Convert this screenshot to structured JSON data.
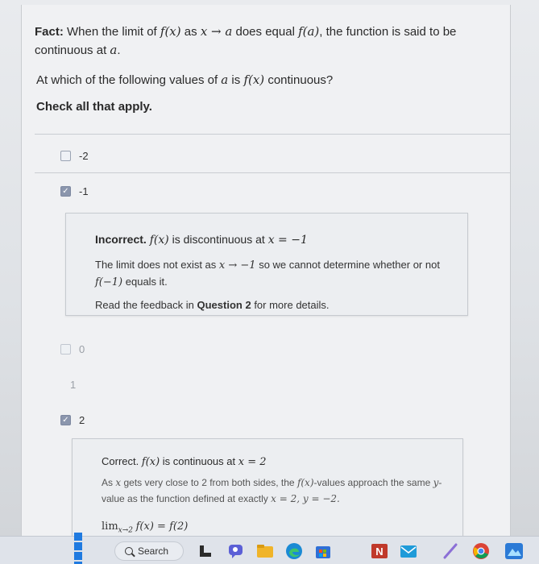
{
  "fact": {
    "label": "Fact:",
    "p1": "When the limit of",
    "fx": "f(x)",
    "p2": "as",
    "arrow": "x → a",
    "p3": "does equal",
    "fa": "f(a)",
    "p4": ", the function is said to be continuous at",
    "a": "a",
    "end": "."
  },
  "question": {
    "p1": "At which of the following values of",
    "a": "a",
    "p2": "is",
    "fx": "f(x)",
    "p3": "continuous?"
  },
  "instruction": "Check all that apply.",
  "choices": [
    {
      "label": "-2",
      "checked": false
    },
    {
      "label": "-1",
      "checked": true
    },
    {
      "label": "0",
      "checked": false
    },
    {
      "label": "1",
      "checked": false
    },
    {
      "label": "2",
      "checked": true
    }
  ],
  "feedback_incorrect": {
    "status": "Incorrect.",
    "title_math": "f(x)",
    "title_text": "is discontinuous at",
    "title_eq": "x = −1",
    "line1_a": "The limit does not exist as",
    "line1_math": "x → −1",
    "line1_b": "so we cannot determine whether or not",
    "line2_math": "f(−1)",
    "line2_b": "equals it.",
    "read_a": "Read the feedback in",
    "read_link": "Question 2",
    "read_b": "for more details."
  },
  "feedback_correct": {
    "status": "Correct.",
    "title_math": "f(x)",
    "title_text": "is continuous at",
    "title_eq": "x = 2",
    "line1_a": "As",
    "line1_x": "x",
    "line1_b": "gets very close to 2 from both sides, the",
    "line1_fx": "f(x)",
    "line1_c": "-values approach the same",
    "line1_y": "y",
    "line1_d": "-",
    "line2_a": "value as the function defined at exactly",
    "line2_math": "x = 2, y = −2.",
    "limit_expr": "lim",
    "limit_sub": "x→2",
    "limit_rest": "f(x) = f(2)"
  },
  "taskbar": {
    "search_label": "Search",
    "colors": {
      "windows": "#1f7ae0",
      "accent": "#2f6fd6"
    },
    "icons": [
      "widgets-icon",
      "chat-icon",
      "file-explorer-icon",
      "edge-icon",
      "store-icon",
      "onenote-icon",
      "mail-icon",
      "pen-icon",
      "chrome-icon",
      "photos-icon"
    ]
  }
}
